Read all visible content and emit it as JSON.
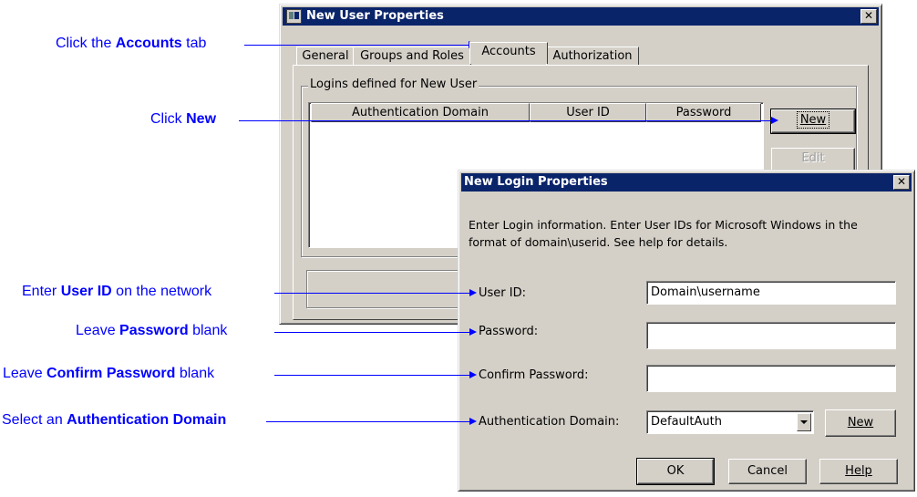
{
  "user_window": {
    "title": "New User Properties",
    "tabs": [
      "General",
      "Groups and Roles",
      "Accounts",
      "Authorization"
    ],
    "group_label": "Logins defined for New User",
    "columns": [
      "Authentication Domain",
      "User ID",
      "Password"
    ],
    "new_button": "New",
    "edit_button": "Edit"
  },
  "login_dialog": {
    "title": "New Login Properties",
    "instructions_1": "Enter Login information. Enter User IDs for Microsoft Windows in the",
    "instructions_2": "format of domain\\userid. See help for details.",
    "user_id_label": "User ID:",
    "user_id_value": "Domain\\username",
    "password_label": "Password:",
    "password_value": "",
    "confirm_label": "Confirm Password:",
    "confirm_value": "",
    "domain_label": "Authentication Domain:",
    "domain_value": "DefaultAuth",
    "domain_new_button": "New",
    "ok_button": "OK",
    "cancel_button": "Cancel",
    "help_button": "Help"
  },
  "annotations": {
    "accounts": {
      "pre": "Click the ",
      "bold": "Accounts",
      "post": " tab"
    },
    "new": {
      "pre": "Click ",
      "bold": "New",
      "post": ""
    },
    "user_id": {
      "pre": "Enter ",
      "bold": "User ID",
      "post": " on the network"
    },
    "password": {
      "pre": "Leave ",
      "bold": "Password",
      "post": " blank"
    },
    "confirm": {
      "pre": "Leave ",
      "bold": "Confirm Password",
      "post": " blank"
    },
    "domain": {
      "pre": "Select an ",
      "bold": "Authentication Domain",
      "post": ""
    }
  }
}
